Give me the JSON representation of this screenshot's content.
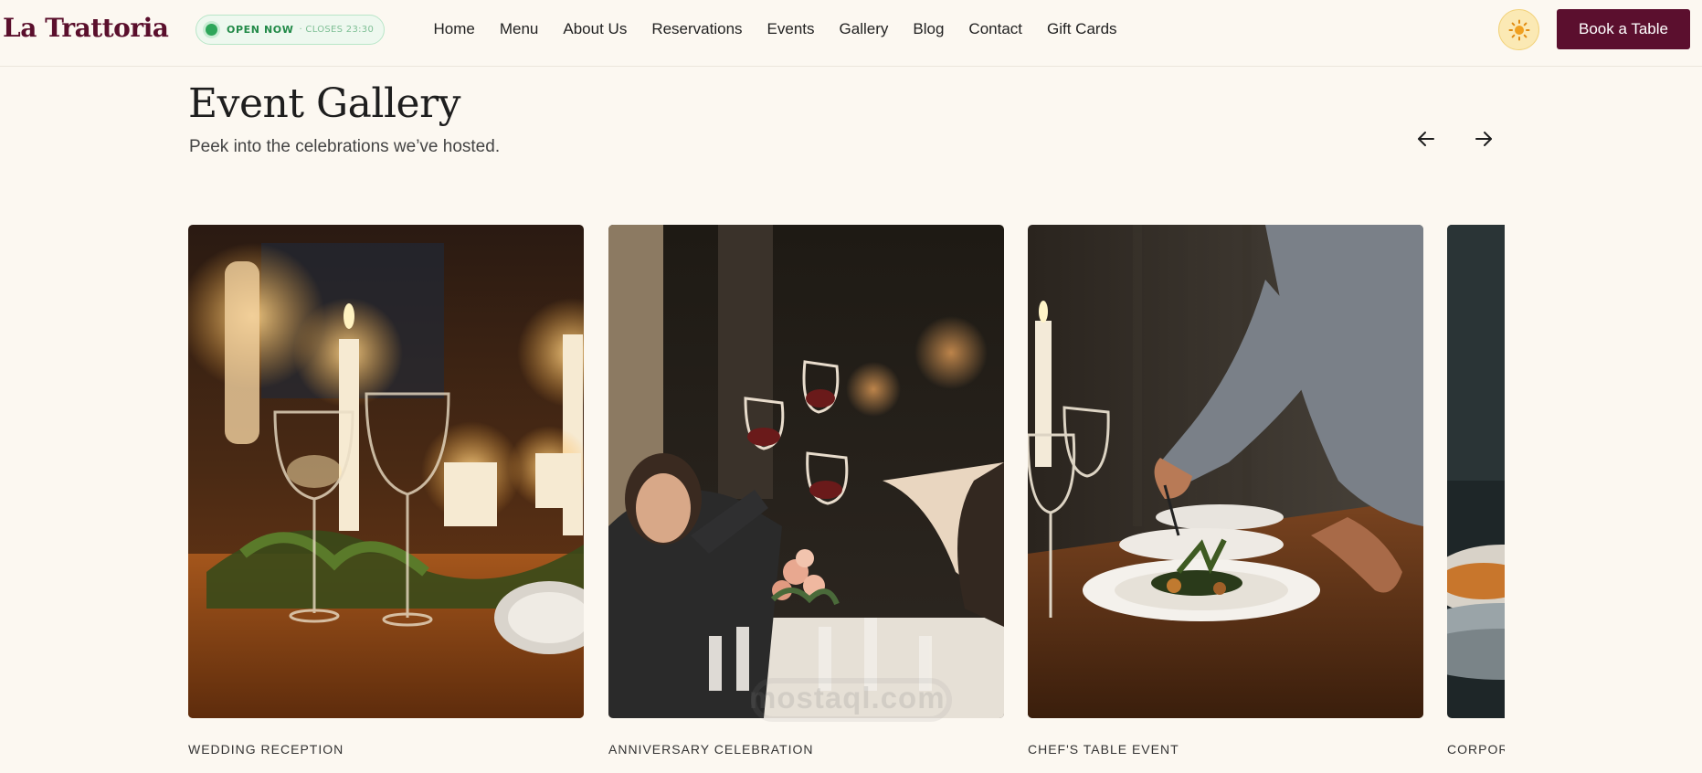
{
  "brand": {
    "name": "La Trattoria",
    "accent": "#5b0f2e"
  },
  "status": {
    "open_label": "OPEN NOW",
    "closes_text": "· CLOSES 23:30",
    "color": "#2ea65a"
  },
  "nav": {
    "items": [
      "Home",
      "Menu",
      "About Us",
      "Reservations",
      "Events",
      "Gallery",
      "Blog",
      "Contact",
      "Gift Cards"
    ]
  },
  "header": {
    "theme_icon": "sun-icon",
    "cta_label": "Book a Table"
  },
  "section": {
    "title": "Event Gallery",
    "subtitle": "Peek into the celebrations we’ve hosted.",
    "prev_icon": "arrow-left-icon",
    "next_icon": "arrow-right-icon"
  },
  "gallery": {
    "cards": [
      {
        "caption": "WEDDING RECEPTION"
      },
      {
        "caption": "ANNIVERSARY CELEBRATION"
      },
      {
        "caption": "CHEF'S TABLE EVENT"
      },
      {
        "caption": "CORPOR..."
      }
    ]
  },
  "watermark": {
    "text": "mostaql.com"
  }
}
